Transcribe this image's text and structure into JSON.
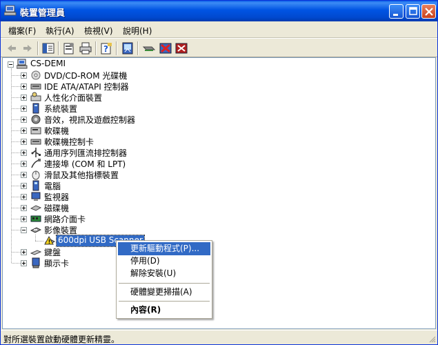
{
  "window": {
    "title": "裝置管理員"
  },
  "menu": [
    {
      "label": "檔案(F)"
    },
    {
      "label": "執行(A)"
    },
    {
      "label": "檢視(V)"
    },
    {
      "label": "說明(H)"
    }
  ],
  "toolbar": {
    "icons": [
      "back-icon",
      "forward-icon",
      "show-hide-console-tree-icon",
      "properties-icon",
      "print-icon",
      "help-icon",
      "scan-hardware-icon",
      "update-driver-icon",
      "disable-icon",
      "uninstall-icon"
    ]
  },
  "tree": {
    "root": "CS-DEMI",
    "categories": [
      {
        "label": "DVD/CD-ROM 光碟機",
        "icon": "cdrom-icon"
      },
      {
        "label": "IDE ATA/ATAPI 控制器",
        "icon": "ide-controller-icon"
      },
      {
        "label": "人性化介面裝置",
        "icon": "hid-icon"
      },
      {
        "label": "系統裝置",
        "icon": "system-device-icon"
      },
      {
        "label": "音效，視訊及遊戲控制器",
        "icon": "sound-icon"
      },
      {
        "label": "軟碟機",
        "icon": "floppy-drive-icon"
      },
      {
        "label": "軟碟機控制卡",
        "icon": "floppy-controller-icon"
      },
      {
        "label": "通用序列匯流排控制器",
        "icon": "usb-icon"
      },
      {
        "label": "連接埠 (COM 和 LPT)",
        "icon": "port-icon"
      },
      {
        "label": "滑鼠及其他指標裝置",
        "icon": "mouse-icon"
      },
      {
        "label": "電腦",
        "icon": "computer-icon"
      },
      {
        "label": "監視器",
        "icon": "monitor-icon"
      },
      {
        "label": "磁碟機",
        "icon": "disk-drive-icon"
      },
      {
        "label": "網路介面卡",
        "icon": "network-adapter-icon"
      },
      {
        "label": "影像裝置",
        "icon": "imaging-device-icon"
      }
    ],
    "imaging_child": "600dpi USB Scanner",
    "after": [
      {
        "label": "鍵盤",
        "icon": "keyboard-icon"
      },
      {
        "label": "顯示卡",
        "icon": "display-adapter-icon"
      }
    ]
  },
  "context_menu": {
    "update_driver": "更新驅動程式(P)...",
    "disable": "停用(D)",
    "uninstall": "解除安裝(U)",
    "scan": "硬體變更掃描(A)",
    "properties": "內容(R)"
  },
  "status": {
    "text": "對所選裝置啟動硬體更新精靈。"
  },
  "colors": {
    "titlebar": "#0054e3",
    "selection": "#316ac5",
    "face": "#ece9d8"
  }
}
